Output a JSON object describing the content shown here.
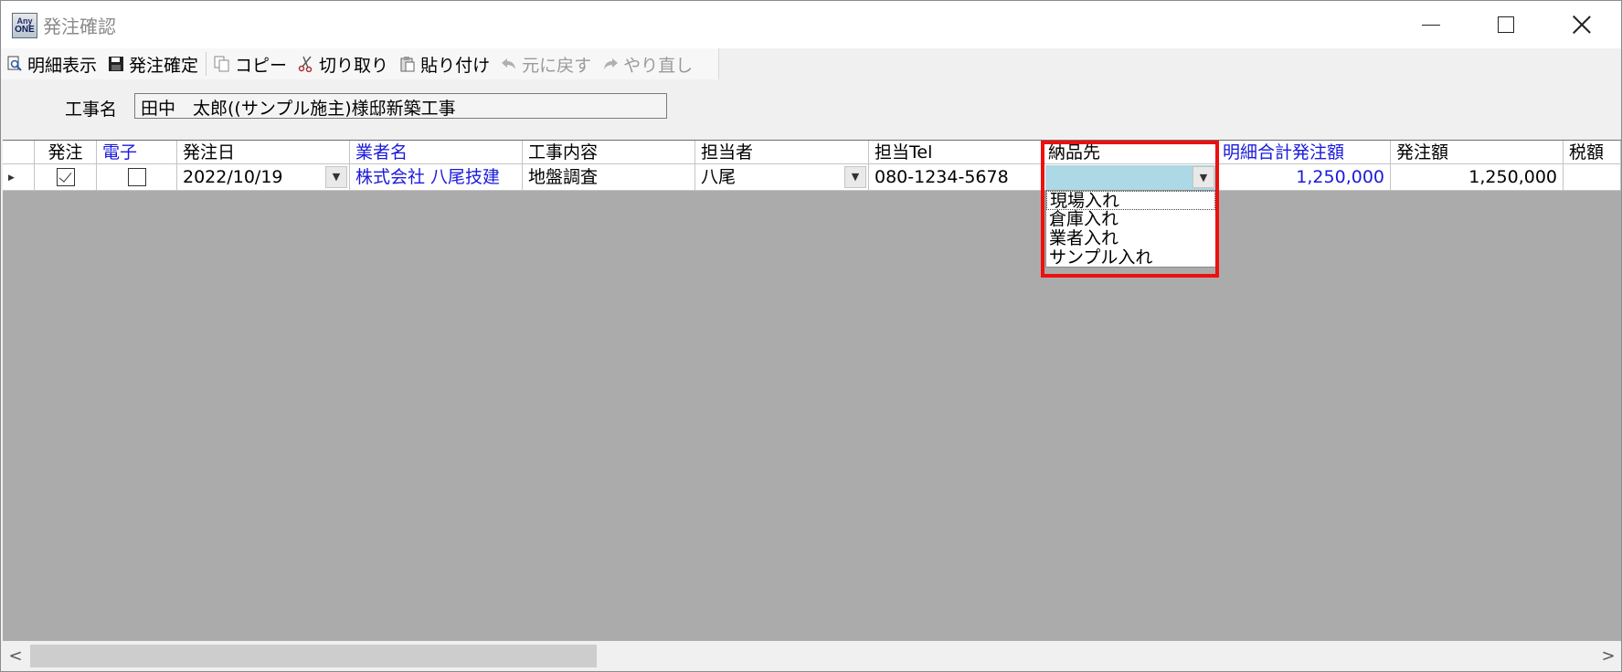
{
  "window": {
    "title": "発注確認",
    "app_icon_top": "Any",
    "app_icon_bottom": "ONE"
  },
  "toolbar": {
    "items": [
      {
        "label": "明細表示",
        "icon": "magnifier-doc-icon",
        "enabled": true
      },
      {
        "label": "発注確定",
        "icon": "floppy-disk-icon",
        "enabled": true
      },
      {
        "label": "コピー",
        "icon": "copy-icon",
        "enabled": true
      },
      {
        "label": "切り取り",
        "icon": "scissors-icon",
        "enabled": true
      },
      {
        "label": "貼り付け",
        "icon": "paste-icon",
        "enabled": true
      },
      {
        "label": "元に戻す",
        "icon": "undo-arrow-icon",
        "enabled": false
      },
      {
        "label": "やり直し",
        "icon": "redo-arrow-icon",
        "enabled": false
      }
    ]
  },
  "project": {
    "label": "工事名",
    "value": "田中　太郎((サンプル施主)様邸新築工事"
  },
  "grid": {
    "headers": {
      "order": "発注",
      "electronic": "電子",
      "order_date": "発注日",
      "vendor": "業者名",
      "work": "工事内容",
      "person": "担当者",
      "tel": "担当Tel",
      "delivery": "納品先",
      "detail_total": "明細合計発注額",
      "order_amount": "発注額",
      "tax": "税額"
    },
    "row": {
      "order_checked": true,
      "electronic_checked": false,
      "order_date": "2022/10/19",
      "vendor": "株式会社 八尾技建",
      "work": "地盤調査",
      "person": "八尾",
      "tel": "080-1234-5678",
      "delivery": "",
      "detail_total": "1,250,000",
      "order_amount": "1,250,000",
      "tax": ""
    },
    "delivery_options": [
      "現場入れ",
      "倉庫入れ",
      "業者入れ",
      "サンプル入れ"
    ],
    "header_blue_color": "#1a1adc",
    "highlight_color": "#ee0f0f",
    "edit_cell_color": "#add8e6"
  }
}
